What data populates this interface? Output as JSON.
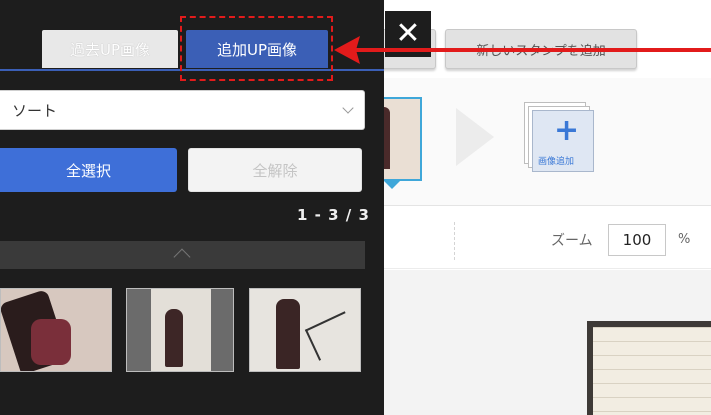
{
  "panel": {
    "tabs": [
      {
        "label": "過去UP画像",
        "active": false
      },
      {
        "label": "追加UP画像",
        "active": true
      }
    ],
    "sort": {
      "value": "ソート"
    },
    "buttons": {
      "select_all": "全選択",
      "deselect_all": "全解除"
    },
    "page_count": "1 - 3 / 3",
    "thumbnails": [
      {
        "icon": "photo-thumbnail-1"
      },
      {
        "icon": "photo-thumbnail-2"
      },
      {
        "icon": "photo-thumbnail-3"
      }
    ]
  },
  "editor": {
    "add_stamp_button": "新しいスタンプを追加",
    "add_image_label": "画像追加",
    "zoom": {
      "label": "ズーム",
      "value": "100",
      "unit": "%"
    }
  },
  "overlay": {
    "close_glyph": "✕",
    "highlight_color": "#e21b1b"
  },
  "colors": {
    "accent_blue": "#3b5fb6",
    "panel_bg": "#1d1d1d",
    "annotation_red": "#e21b1b"
  }
}
